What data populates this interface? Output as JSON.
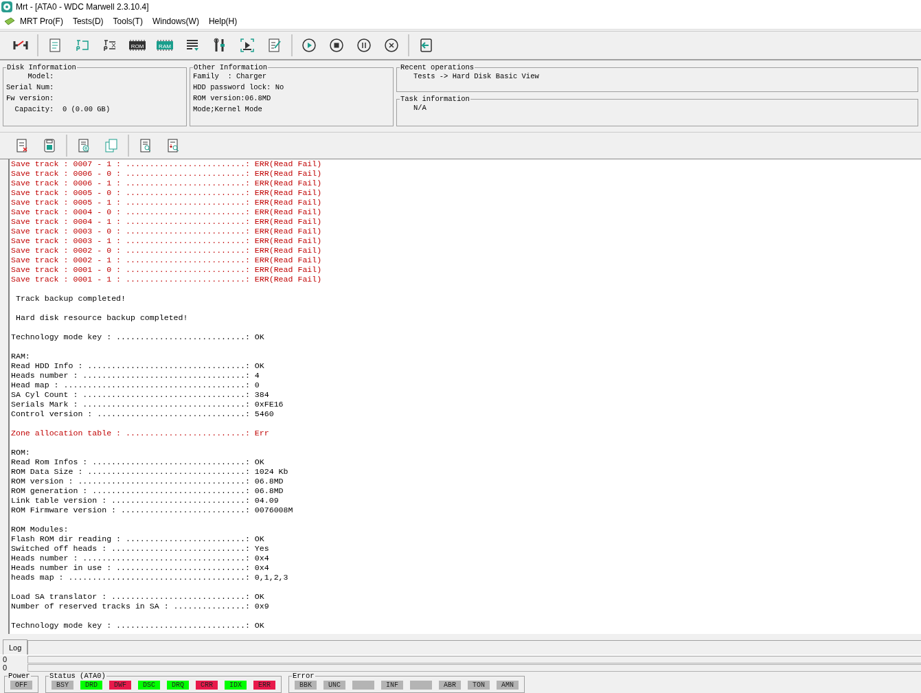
{
  "window": {
    "title": "Mrt - [ATA0 - WDC Marwell 2.3.10.4]"
  },
  "menu": [
    "MRT Pro(F)",
    "Tests(D)",
    "Tools(T)",
    "Windows(W)",
    "Help(H)"
  ],
  "toolbar": [
    [
      {
        "kind": "connect"
      }
    ],
    [
      {
        "kind": "doc"
      },
      {
        "kind": "tr"
      },
      {
        "kind": "trx"
      },
      {
        "kind": "chip",
        "label": "ROM"
      },
      {
        "kind": "chip",
        "label": "RAM"
      },
      {
        "kind": "list"
      },
      {
        "kind": "tools"
      },
      {
        "kind": "screen"
      },
      {
        "kind": "edit"
      }
    ],
    [
      {
        "kind": "play"
      },
      {
        "kind": "stop"
      },
      {
        "kind": "pause"
      },
      {
        "kind": "cancel"
      }
    ],
    [
      {
        "kind": "exit"
      }
    ]
  ],
  "disk_info": {
    "title": "Disk Information",
    "lines": [
      "     Model:",
      "Serial Num:",
      "Fw version:",
      "  Capacity:  0 (0.00 GB)"
    ]
  },
  "other_info": {
    "title": "Other Information",
    "lines": [
      "Family  : Charger",
      "HDD password lock: No",
      "ROM version:06.8MD",
      "Mode;Kernel Mode"
    ]
  },
  "recent": {
    "title": "Recent operations",
    "text": "Tests -> Hard Disk Basic View"
  },
  "task": {
    "title": "Task information",
    "text": "N/A"
  },
  "log_toolbar": [
    [
      {
        "kind": "clear"
      },
      {
        "kind": "save"
      }
    ],
    [
      {
        "kind": "pause-doc"
      },
      {
        "kind": "copy"
      }
    ],
    [
      {
        "kind": "find"
      },
      {
        "kind": "find-down"
      }
    ]
  ],
  "log": [
    {
      "lines": [
        {
          "kind": "error",
          "text": "Save track : 0007 - 1 : .........................: ERR(Read Fail)"
        },
        {
          "kind": "error",
          "text": "Save track : 0006 - 0 : .........................: ERR(Read Fail)"
        },
        {
          "kind": "error",
          "text": "Save track : 0006 - 1 : .........................: ERR(Read Fail)"
        },
        {
          "kind": "error",
          "text": "Save track : 0005 - 0 : .........................: ERR(Read Fail)"
        },
        {
          "kind": "error",
          "text": "Save track : 0005 - 1 : .........................: ERR(Read Fail)"
        },
        {
          "kind": "error",
          "text": "Save track : 0004 - 0 : .........................: ERR(Read Fail)"
        },
        {
          "kind": "error",
          "text": "Save track : 0004 - 1 : .........................: ERR(Read Fail)"
        },
        {
          "kind": "error",
          "text": "Save track : 0003 - 0 : .........................: ERR(Read Fail)"
        },
        {
          "kind": "error",
          "text": "Save track : 0003 - 1 : .........................: ERR(Read Fail)"
        },
        {
          "kind": "error",
          "text": "Save track : 0002 - 0 : .........................: ERR(Read Fail)"
        },
        {
          "kind": "error",
          "text": "Save track : 0002 - 1 : .........................: ERR(Read Fail)"
        },
        {
          "kind": "error",
          "text": "Save track : 0001 - 0 : .........................: ERR(Read Fail)"
        },
        {
          "kind": "error",
          "text": "Save track : 0001 - 1 : .........................: ERR(Read Fail)"
        }
      ]
    },
    {
      "lines": [
        {
          "kind": "note",
          "text": "Track backup completed!"
        }
      ]
    },
    {
      "lines": [
        {
          "kind": "note",
          "text": "Hard disk resource backup completed!"
        }
      ]
    },
    {
      "lines": [
        {
          "kind": "normal",
          "text": "Technology mode key : ...........................: OK"
        }
      ]
    },
    {
      "lines": [
        {
          "kind": "normal",
          "text": "RAM:"
        },
        {
          "kind": "normal",
          "text": "Read HDD Info : .................................: OK"
        },
        {
          "kind": "normal",
          "text": "Heads number : ..................................: 4"
        },
        {
          "kind": "normal",
          "text": "Head map : ......................................: 0"
        },
        {
          "kind": "normal",
          "text": "SA Cyl Count : ..................................: 384"
        },
        {
          "kind": "normal",
          "text": "Serials Mark : ..................................: 0xFE16"
        },
        {
          "kind": "normal",
          "text": "Control version : ...............................: 5460"
        }
      ]
    },
    {
      "lines": [
        {
          "kind": "error",
          "text": "Zone allocation table : .........................: Err"
        }
      ]
    },
    {
      "lines": [
        {
          "kind": "normal",
          "text": "ROM:"
        },
        {
          "kind": "normal",
          "text": "Read Rom Infos : ................................: OK"
        },
        {
          "kind": "normal",
          "text": "ROM Data Size : .................................: 1024 Kb"
        },
        {
          "kind": "normal",
          "text": "ROM version : ...................................: 06.8MD"
        },
        {
          "kind": "normal",
          "text": "ROM generation : ................................: 06.8MD"
        },
        {
          "kind": "normal",
          "text": "Link table version : ............................: 04.09"
        },
        {
          "kind": "normal",
          "text": "ROM Firmware version : ..........................: 0076008M"
        }
      ]
    },
    {
      "lines": [
        {
          "kind": "normal",
          "text": "ROM Modules:"
        },
        {
          "kind": "normal",
          "text": "Flash ROM dir reading : .........................: OK"
        },
        {
          "kind": "normal",
          "text": "Switched off heads : ............................: Yes"
        },
        {
          "kind": "normal",
          "text": "Heads number : ..................................: 0x4"
        },
        {
          "kind": "normal",
          "text": "Heads number in use : ...........................: 0x4"
        },
        {
          "kind": "normal",
          "text": "heads map : .....................................: 0,1,2,3"
        }
      ]
    },
    {
      "lines": [
        {
          "kind": "normal",
          "text": "Load SA translator : ............................: OK"
        },
        {
          "kind": "normal",
          "text": "Number of reserved tracks in SA : ...............: 0x9"
        }
      ]
    },
    {
      "lines": [
        {
          "kind": "normal",
          "text": "Technology mode key : ...........................: OK"
        }
      ]
    }
  ],
  "log_tab": {
    "label": "Log",
    "selected": true
  },
  "progress": [
    {
      "value": "0"
    },
    {
      "value": "0"
    }
  ],
  "power": {
    "title": "Power",
    "flags": [
      {
        "label": "OFF",
        "color": "#b4b4b4"
      }
    ]
  },
  "status": {
    "title": "Status (ATA0)",
    "flags": [
      {
        "label": "BSY",
        "color": "#b4b4b4"
      },
      {
        "label": "DRD",
        "color": "#00ff00"
      },
      {
        "label": "DWF",
        "color": "#e8194b"
      },
      {
        "label": "DSC",
        "color": "#00ff00"
      },
      {
        "label": "DRQ",
        "color": "#00ff00"
      },
      {
        "label": "CRR",
        "color": "#e8194b"
      },
      {
        "label": "IDX",
        "color": "#00ff00"
      },
      {
        "label": "ERR",
        "color": "#e8194b"
      }
    ]
  },
  "error": {
    "title": "Error",
    "flags": [
      {
        "label": "BBK",
        "color": "#b4b4b4"
      },
      {
        "label": "UNC",
        "color": "#b4b4b4"
      },
      {
        "color": "#b4b4b4"
      },
      {
        "label": "INF",
        "color": "#b4b4b4"
      },
      {
        "color": "#b4b4b4"
      },
      {
        "label": "ABR",
        "color": "#b4b4b4"
      },
      {
        "label": "TON",
        "color": "#b4b4b4"
      },
      {
        "label": "AMN",
        "color": "#b4b4b4"
      }
    ]
  }
}
